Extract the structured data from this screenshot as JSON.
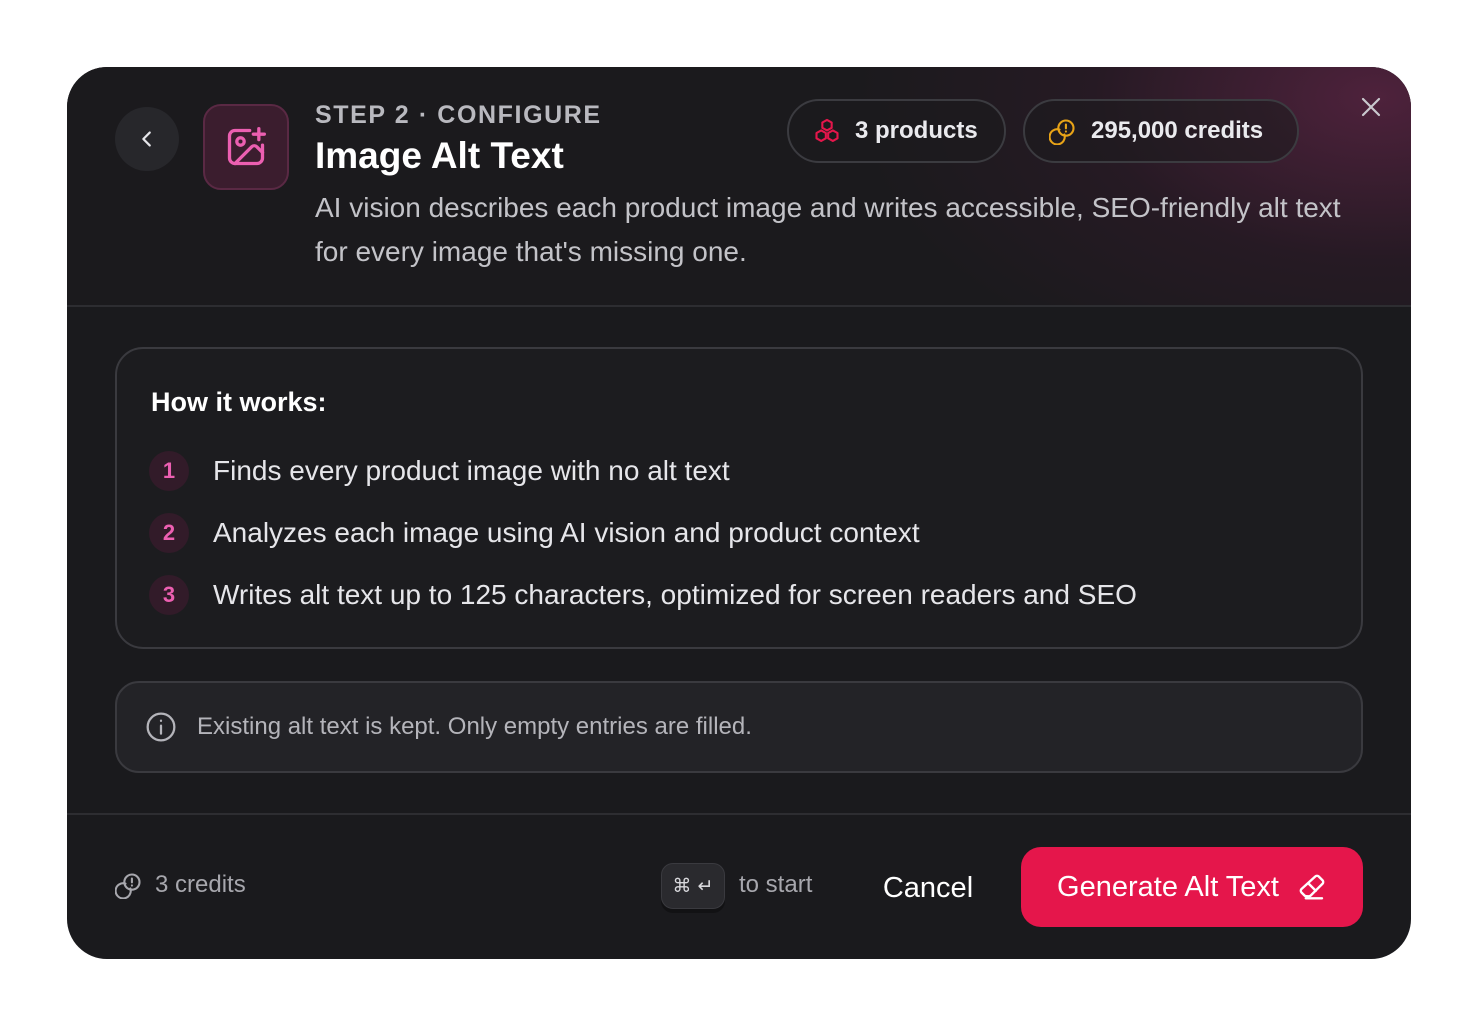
{
  "header": {
    "back_icon": "chevron-left-icon",
    "feature_icon": "image-plus-icon",
    "step_label": "STEP 2 · CONFIGURE",
    "title": "Image Alt Text",
    "description": "AI vision describes each product image and writes accessible, SEO-friendly alt text for every image that's missing one.",
    "products_pill": {
      "icon": "boxes-icon",
      "label": "3 products"
    },
    "credits_pill": {
      "icon": "coins-icon",
      "label": "295,000 credits"
    },
    "close_icon": "close-icon"
  },
  "how_it_works": {
    "title": "How it works:",
    "steps": [
      {
        "number": "1",
        "text": "Finds every product image with no alt text"
      },
      {
        "number": "2",
        "text": "Analyzes each image using AI vision and product context"
      },
      {
        "number": "3",
        "text": "Writes alt text up to 125 characters, optimized for screen readers and SEO"
      }
    ]
  },
  "info": {
    "icon": "info-icon",
    "text": "Existing alt text is kept. Only empty entries are filled."
  },
  "footer": {
    "cost_icon": "coins-icon",
    "cost_label": "3 credits",
    "shortcut_keys": [
      "⌘",
      "↵"
    ],
    "shortcut_hint": "to start",
    "cancel_label": "Cancel",
    "primary_label": "Generate Alt Text",
    "primary_icon": "eraser-icon"
  },
  "colors": {
    "accent": "#e5164b",
    "step_number": "#ec5fb1",
    "coin": "#e8a317",
    "modal_bg": "#1a1a1d"
  }
}
